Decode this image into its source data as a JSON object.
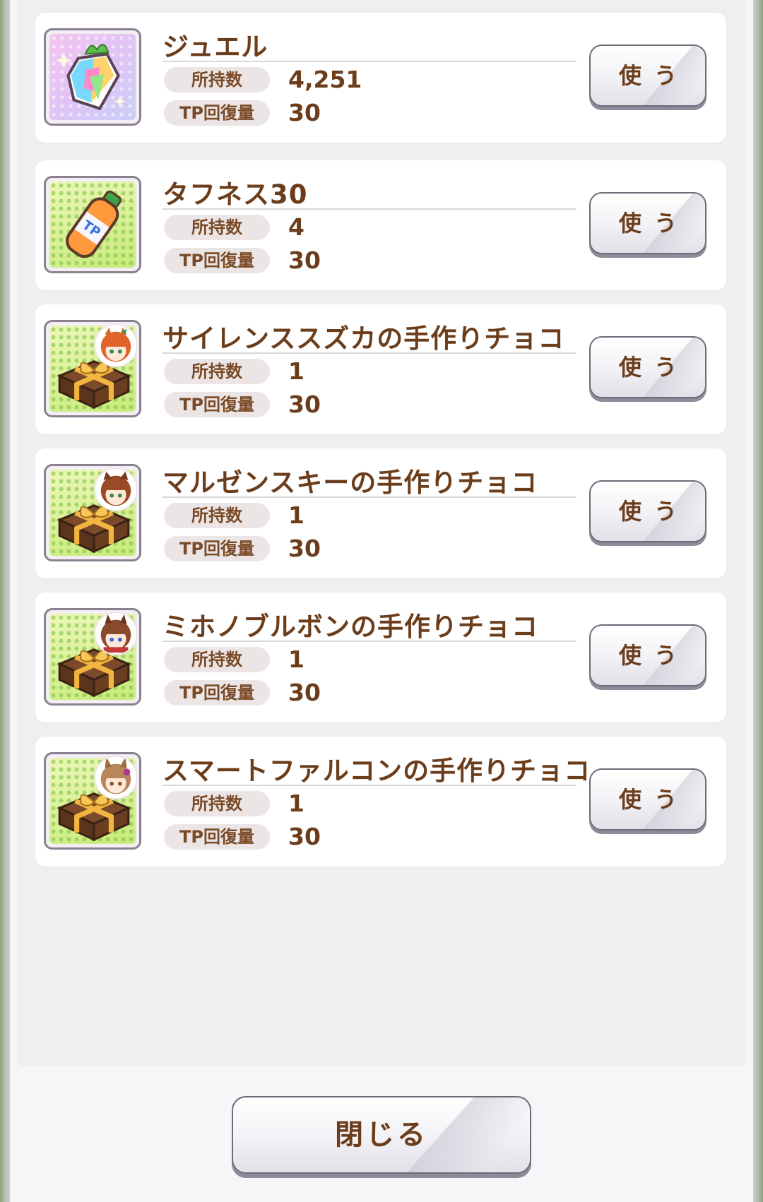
{
  "items": [
    {
      "name": "ジュエル",
      "icon": "jewel-icon",
      "owned_label": "所持数",
      "owned": "4,251",
      "tp_label": "TP回復量",
      "tp": "30",
      "use_label": "使う"
    },
    {
      "name": "タフネス30",
      "icon": "tp-bottle-icon",
      "owned_label": "所持数",
      "owned": "4",
      "tp_label": "TP回復量",
      "tp": "30",
      "use_label": "使う"
    },
    {
      "name": "サイレンススズカの手作りチョコ",
      "icon": "chocolate-gift-icon",
      "owned_label": "所持数",
      "owned": "1",
      "tp_label": "TP回復量",
      "tp": "30",
      "use_label": "使う"
    },
    {
      "name": "マルゼンスキーの手作りチョコ",
      "icon": "chocolate-gift-icon",
      "owned_label": "所持数",
      "owned": "1",
      "tp_label": "TP回復量",
      "tp": "30",
      "use_label": "使う"
    },
    {
      "name": "ミホノブルボンの手作りチョコ",
      "icon": "chocolate-gift-icon",
      "owned_label": "所持数",
      "owned": "1",
      "tp_label": "TP回復量",
      "tp": "30",
      "use_label": "使う"
    },
    {
      "name": "スマートファルコンの手作りチョコ",
      "icon": "chocolate-gift-icon",
      "owned_label": "所持数",
      "owned": "1",
      "tp_label": "TP回復量",
      "tp": "30",
      "use_label": "使う"
    }
  ],
  "close_label": "閉じる",
  "colors": {
    "text_brown": "#6b3d1b",
    "card_bg": "#ffffff",
    "panel_bg": "#efeff2"
  }
}
